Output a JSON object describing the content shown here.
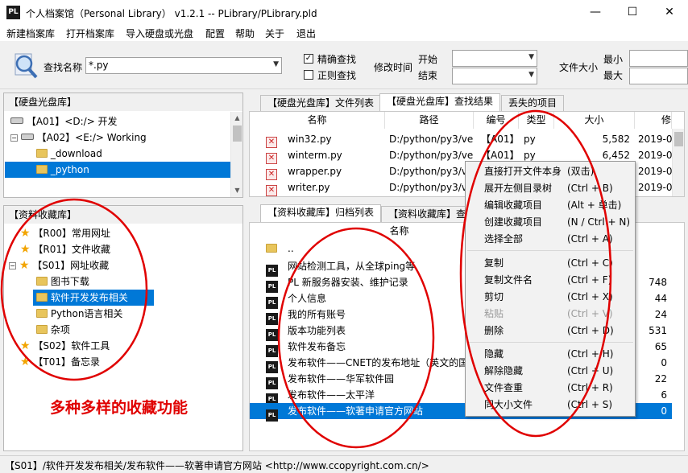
{
  "window": {
    "title": "个人档案馆（Personal Library） v1.2.1 -- PLibrary/PLibrary.pld",
    "app_icon": "PL",
    "min_glyph": "—",
    "max_glyph": "☐",
    "close_glyph": "✕"
  },
  "menu": [
    "新建档案库",
    "打开档案库",
    "导入硬盘或光盘",
    "配置",
    "帮助",
    "关于",
    "退出"
  ],
  "toolbar": {
    "search_label": "查找名称",
    "search_value": "*.py",
    "exact_label": "精确查找",
    "exact_checked": "✓",
    "regex_label": "正则查找",
    "regex_checked": "",
    "modtime_label": "修改时间",
    "start_label": "开始",
    "end_label": "结束",
    "size_label": "文件大小",
    "min_label": "最小",
    "max_label": "最大"
  },
  "disk_panel": {
    "title": "【硬盘光盘库】",
    "rows": [
      {
        "toggle": "",
        "label": "【A01】<D:/> 开发",
        "kind": "drive"
      },
      {
        "toggle": "−",
        "label": "【A02】<E:/> Working",
        "kind": "drive"
      },
      {
        "label": "_download",
        "kind": "folder"
      },
      {
        "label": "_python",
        "kind": "folder"
      }
    ]
  },
  "collection_panel": {
    "title": "【资料收藏库】",
    "rows": [
      {
        "label": "【R00】常用网址",
        "kind": "star"
      },
      {
        "label": "【R01】文件收藏",
        "kind": "star"
      },
      {
        "toggle": "−",
        "label": "【S01】网址收藏",
        "kind": "star"
      },
      {
        "label": "图书下载",
        "kind": "folder"
      },
      {
        "label": "软件开发发布相关",
        "kind": "folder"
      },
      {
        "label": "Python语言相关",
        "kind": "folder"
      },
      {
        "label": "杂项",
        "kind": "folder"
      },
      {
        "label": "【S02】软件工具",
        "kind": "star"
      },
      {
        "label": "【T01】备忘录",
        "kind": "star"
      }
    ]
  },
  "top_tabs": [
    "【硬盘光盘库】文件列表",
    "【硬盘光盘库】查找结果",
    "丢失的项目"
  ],
  "search_table": {
    "columns": [
      "名称",
      "路径",
      "编号",
      "类型",
      "大小",
      "修"
    ],
    "rows": [
      {
        "name": "win32.py",
        "path": "D:/python/py3/ve",
        "id": "【A01】",
        "type": "py",
        "size": "5,582",
        "date": "2019-0"
      },
      {
        "name": "winterm.py",
        "path": "D:/python/py3/ve",
        "id": "【A01】",
        "type": "py",
        "size": "6,452",
        "date": "2019-0"
      },
      {
        "name": "wrapper.py",
        "path": "D:/python/py3/ve",
        "id": "",
        "type": "",
        "size": "",
        "date": "2019-0"
      },
      {
        "name": "writer.py",
        "path": "D:/python/py3/ve",
        "id": "",
        "type": "",
        "size": "",
        "date": "2019-0"
      }
    ]
  },
  "bottom_tabs": [
    "【资料收藏库】归档列表",
    "【资料收藏库】查"
  ],
  "archive_table": {
    "columns": [
      "名称"
    ],
    "rows": [
      {
        "name": "..",
        "size": "",
        "kind": "up"
      },
      {
        "name": "网站检测工具，从全球ping等",
        "size": "",
        "kind": "pl"
      },
      {
        "name": "PL 新服务器安装、维护记录",
        "size": "748",
        "kind": "pl"
      },
      {
        "name": "个人信息",
        "size": "44",
        "kind": "pl"
      },
      {
        "name": "我的所有账号",
        "size": "24",
        "kind": "pl"
      },
      {
        "name": "版本功能列表",
        "size": "531",
        "kind": "pl"
      },
      {
        "name": "软件发布备忘",
        "size": "65",
        "kind": "pl"
      },
      {
        "name": "发布软件——CNET的发布地址（英文的国",
        "size": "0",
        "kind": "pl"
      },
      {
        "name": "发布软件——华军软件园",
        "size": "22",
        "kind": "pl"
      },
      {
        "name": "发布软件——太平洋",
        "size": "6",
        "kind": "pl"
      },
      {
        "name": "发布软件——软著申请官方网站",
        "size": "0",
        "kind": "pl"
      }
    ]
  },
  "context_menu": [
    {
      "label": "直接打开文件本身",
      "shortcut": "(双击)"
    },
    {
      "label": "展开左侧目录树",
      "shortcut": "(Ctrl + B)"
    },
    {
      "label": "编辑收藏项目",
      "shortcut": "(Alt + 单击)"
    },
    {
      "label": "创建收藏项目",
      "shortcut": "(N / Ctrl + N)"
    },
    {
      "label": "选择全部",
      "shortcut": "(Ctrl + A)"
    },
    {
      "label": "复制",
      "shortcut": "(Ctrl + C)"
    },
    {
      "label": "复制文件名",
      "shortcut": "(Ctrl + F)"
    },
    {
      "label": "剪切",
      "shortcut": "(Ctrl + X)"
    },
    {
      "label": "粘贴",
      "shortcut": "(Ctrl + V)"
    },
    {
      "label": "删除",
      "shortcut": "(Ctrl + D)"
    },
    {
      "label": "隐藏",
      "shortcut": "(Ctrl + H)"
    },
    {
      "label": "解除隐藏",
      "shortcut": "(Ctrl + U)"
    },
    {
      "label": "文件查重",
      "shortcut": "(Ctrl + R)"
    },
    {
      "label": "同大小文件",
      "shortcut": "(Ctrl + S)"
    }
  ],
  "status": "【S01】/软件开发发布相关/发布软件——软著申请官方网站 <http://www.ccopyright.com.cn/>",
  "annotation": "多种多样的收藏功能",
  "colors": {
    "selection": "#0078d7",
    "annotation": "#e00000"
  }
}
